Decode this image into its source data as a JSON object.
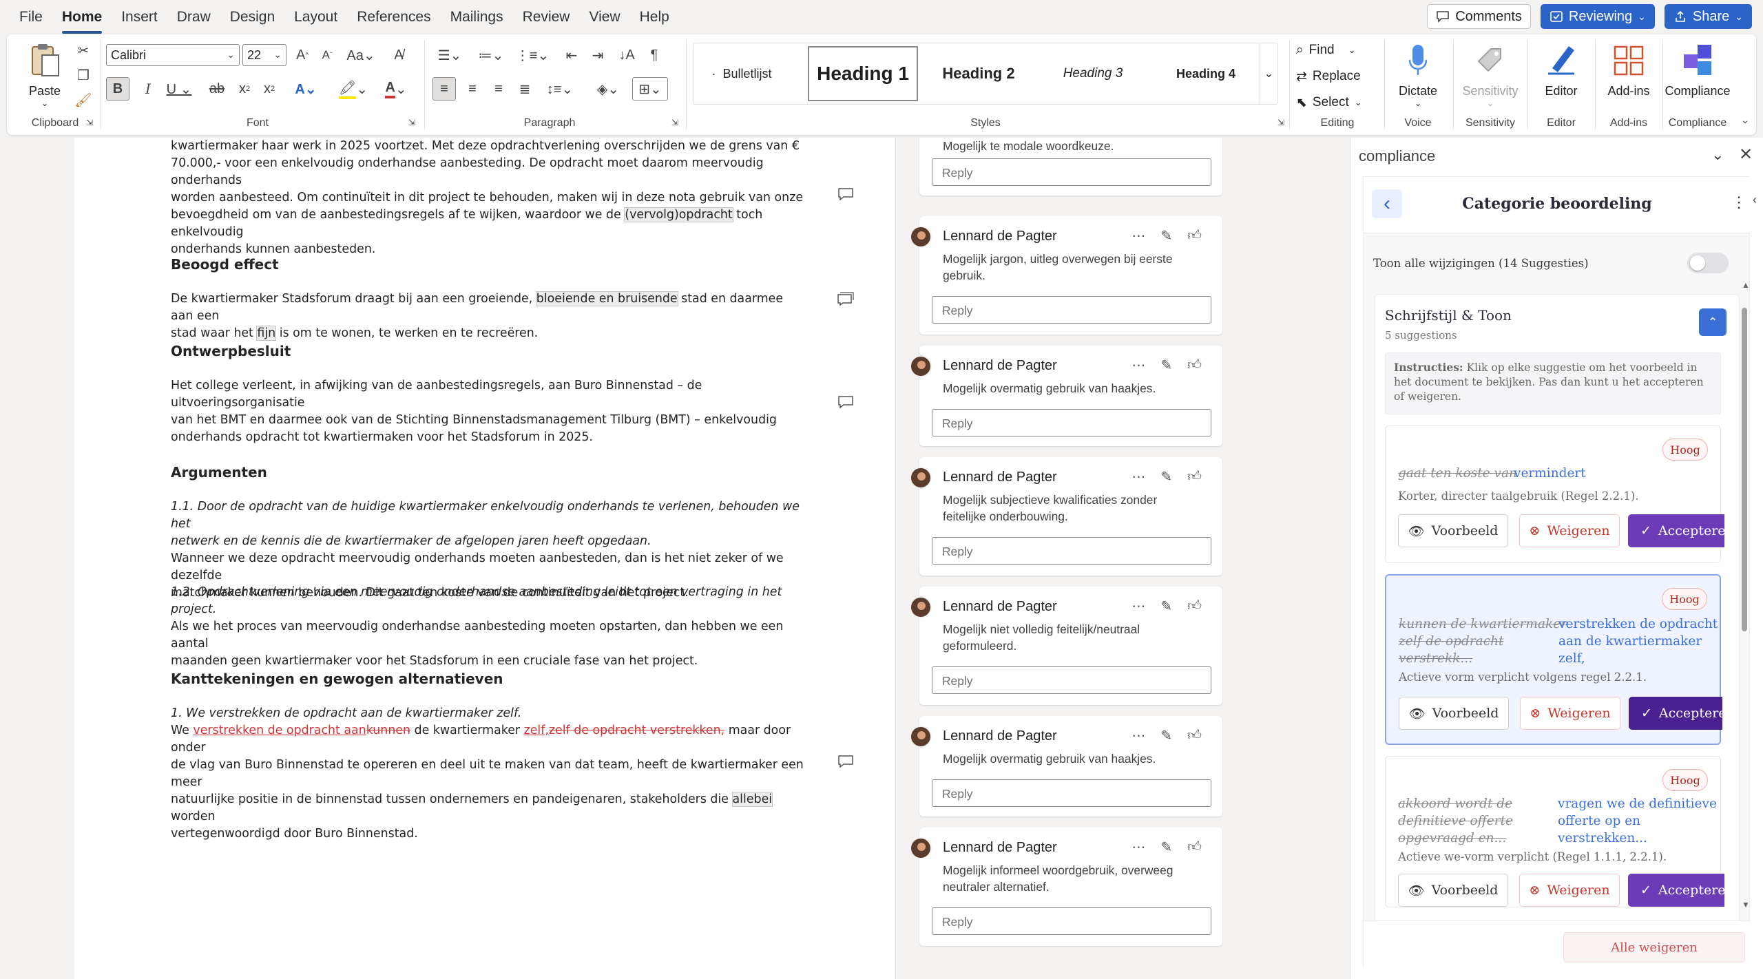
{
  "menu": {
    "items": [
      "File",
      "Home",
      "Insert",
      "Draw",
      "Design",
      "Layout",
      "References",
      "Mailings",
      "Review",
      "View",
      "Help"
    ],
    "active": "Home",
    "comments_label": "Comments",
    "reviewing_label": "Reviewing",
    "share_label": "Share"
  },
  "ribbon": {
    "clipboard": {
      "paste": "Paste",
      "group": "Clipboard"
    },
    "font": {
      "name": "Calibri",
      "size": "22",
      "group": "Font"
    },
    "paragraph": {
      "group": "Paragraph"
    },
    "styles": {
      "items": [
        "Bulletlijst",
        "Heading 1",
        "Heading 2",
        "Heading 3",
        "Heading 4"
      ],
      "group": "Styles"
    },
    "editing": {
      "find": "Find",
      "replace": "Replace",
      "select": "Select",
      "group": "Editing"
    },
    "voice": {
      "dictate": "Dictate",
      "group": "Voice"
    },
    "sensitivity": {
      "label": "Sensitivity",
      "group": "Sensitivity"
    },
    "editor": {
      "label": "Editor",
      "group": "Editor"
    },
    "addins": {
      "label": "Add-ins",
      "group": "Add-ins"
    },
    "compliance": {
      "label": "Compliance",
      "group": "Compliance"
    }
  },
  "document": {
    "p1_l1": "kwartiermaker haar werk in 2025 voortzet. Met deze opdrachtverlening overschrijden we de grens van €",
    "p1_l2": "70.000,- voor een enkelvoudig onderhandse aanbesteding. De opdracht moet daarom meervoudig onderhands",
    "p1_l3": "worden aanbesteed. Om continuïteit in dit project te behouden, maken wij in deze nota gebruik van onze",
    "p1_l4a": "bevoegdheid om van de aanbestedingsregels af te wijken, waardoor we de ",
    "p1_l4_hl": "(vervolg)opdracht",
    "p1_l4b": " toch enkelvoudig",
    "p1_l5": "onderhands kunnen aanbesteden.",
    "h_beoogd": "Beoogd effect",
    "p2_l1a": "De kwartiermaker Stadsforum draagt bij aan een groeiende, ",
    "p2_l1_hl": "bloeiende en bruisende",
    "p2_l1b": " stad en daarmee aan een",
    "p2_l2a": "stad waar het ",
    "p2_l2_hl": "fijn",
    "p2_l2b": " is om te wonen, te werken en te recreëren.",
    "h_ontwerp": "Ontwerpbesluit",
    "p3_l1": "Het college verleent, in afwijking van de aanbestedingsregels, aan Buro Binnenstad – de uitvoeringsorganisatie",
    "p3_l2": "van het BMT en daarmee ook van de Stichting Binnenstadsmanagement Tilburg (BMT) – enkelvoudig",
    "p3_l3": "onderhands opdracht tot kwartiermaken voor het Stadsforum in 2025.",
    "h_arg": "Argumenten",
    "a1_l1": "1.1.  Door de opdracht van de huidige kwartiermaker enkelvoudig onderhands te verlenen, behouden we het",
    "a1_l2": "netwerk en de kennis die de kwartiermaker de afgelopen jaren heeft opgedaan.",
    "a1_l3": "Wanneer we deze opdracht meervoudig onderhands moeten aanbesteden, dan is het niet zeker of we dezelfde",
    "a1_l4": "matchmaker kunnen behouden. Dit gaat ten koste van de continuïteit van het project.",
    "a2_l1": "1.2.  Opdrachtverlening via een meervoudig onderhandse aanbesteding leidt tot een vertraging in het project.",
    "a2_l2": "Als we het proces van meervoudig onderhandse aanbesteding moeten opstarten, dan hebben we een aantal",
    "a2_l3": "maanden geen kwartiermaker voor het Stadsforum in een cruciale fase van het project.",
    "h_kant": "Kanttekeningen en gewogen alternatieven",
    "k_l1": "1. We verstrekken de opdracht aan de kwartiermaker zelf.",
    "k_l2a": "We ",
    "k_l2_ins1": "verstrekken de opdracht aan",
    "k_l2_del1": "kunnen",
    "k_l2b": " de kwartiermaker ",
    "k_l2_ins2": "zelf,",
    "k_l2_del2": "zelf de opdracht verstrekken,",
    "k_l2c": " maar door onder",
    "k_l3": "de vlag van Buro Binnenstad te opereren en deel uit te maken van dat team, heeft de kwartiermaker een meer",
    "k_l4a": "natuurlijke positie in de binnenstad tussen ondernemers en pandeigenaren, stakeholders die ",
    "k_l4_hl": "allebei",
    "k_l4b": " worden",
    "k_l5": "vertegenwoordigd door Buro Binnenstad."
  },
  "comments": {
    "top_text": "Mogelijk te modale woordkeuze.",
    "reply_placeholder": "Reply",
    "items": [
      {
        "author": "Lennard de Pagter",
        "text": "Mogelijk jargon, uitleg overwegen bij eerste gebruik."
      },
      {
        "author": "Lennard de Pagter",
        "text": "Mogelijk overmatig gebruik van haakjes."
      },
      {
        "author": "Lennard de Pagter",
        "text": "Mogelijk subjectieve kwalificaties zonder feitelijke onderbouwing."
      },
      {
        "author": "Lennard de Pagter",
        "text": "Mogelijk niet volledig feitelijk/neutraal geformuleerd."
      },
      {
        "author": "Lennard de Pagter",
        "text": "Mogelijk overmatig gebruik van haakjes."
      },
      {
        "author": "Lennard de Pagter",
        "text": "Mogelijk informeel woordgebruik, overweeg neutraler alternatief."
      }
    ]
  },
  "compliance": {
    "pane_title": "compliance",
    "header_title": "Categorie beoordeling",
    "toggle_label": "Toon alle wijzigingen (14 Suggesties)",
    "category_name": "Schrijfstijl & Toon",
    "category_count": "5 suggestions",
    "instructions_bold": "Instructies:",
    "instructions_text": " Klik op elke suggestie om het voorbeeld in het document te bekijken. Pas dan kunt u het accepteren of weigeren.",
    "priority": "Hoog",
    "btn_preview": "Voorbeeld",
    "btn_reject": "Weigeren",
    "btn_accept": "Accepteren",
    "reject_all": "Alle weigeren",
    "suggestions": [
      {
        "old": "gaat ten koste van",
        "new": "vermindert",
        "desc": "Korter, directer taalgebruik (Regel 2.2.1)."
      },
      {
        "old_l1": "kunnen de kwartiermaker",
        "old_l2": "zelf de opdracht",
        "old_l3": "verstrekk...",
        "new_l1": "verstrekken de opdracht",
        "new_l2": "aan de kwartiermaker",
        "new_l3": "zelf,",
        "desc": "Actieve vorm verplicht volgens regel 2.2.1."
      },
      {
        "old_l1": "akkoord wordt de",
        "old_l2": "definitieve offerte",
        "old_l3": "opgevraagd en...",
        "new_l1": "vragen we de definitieve",
        "new_l2": "offerte op en",
        "new_l3": "verstrekken...",
        "desc": "Actieve we-vorm verplicht (Regel 1.1.1, 2.2.1)."
      }
    ]
  }
}
